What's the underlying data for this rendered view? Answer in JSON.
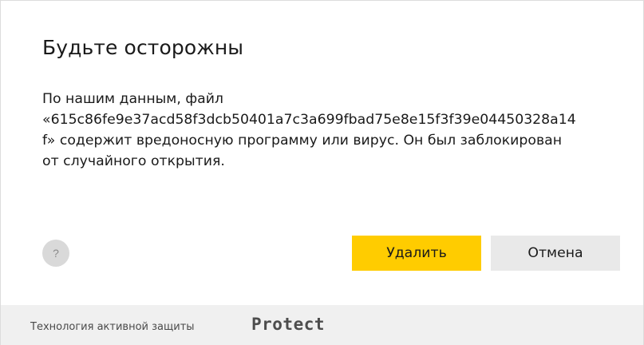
{
  "dialog": {
    "title": "Будьте осторожны",
    "message_lines": [
      "По нашим данным, файл",
      "«615c86fe9e37acd58f3dcb50401a7c3a699fbad75e8e15f3f39e04450328a14",
      "f» содержит вредоносную программу или вирус. Он был заблокирован",
      "от случайного открытия."
    ],
    "help_label": "?",
    "delete_label": "Удалить",
    "cancel_label": "Отмена"
  },
  "footer": {
    "text": "Технология активной защиты",
    "logo": "Protect"
  },
  "colors": {
    "primary_button": "#ffcc00",
    "secondary_button": "#e9e9e9",
    "footer_background": "#f0f0f0",
    "help_button": "#d9d9d9"
  },
  "icons": {
    "help": "question-mark-icon"
  }
}
